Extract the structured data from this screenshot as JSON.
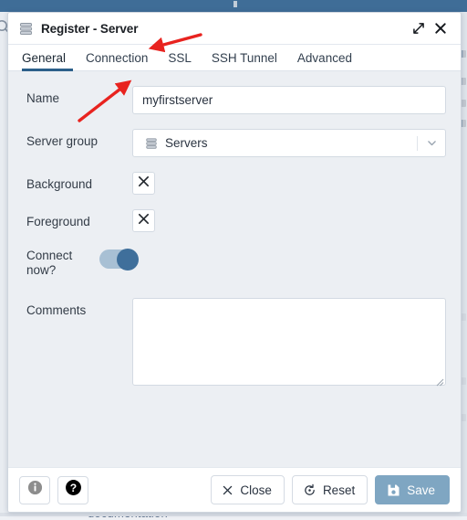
{
  "dialog": {
    "title": "Register - Server",
    "title_icon": "server-stack-icon",
    "maximize_icon": "expand-icon",
    "close_icon": "close-icon",
    "tabs": [
      {
        "label": "General",
        "active": true
      },
      {
        "label": "Connection",
        "active": false
      },
      {
        "label": "SSL",
        "active": false
      },
      {
        "label": "SSH Tunnel",
        "active": false
      },
      {
        "label": "Advanced",
        "active": false
      }
    ],
    "form": {
      "name": {
        "label": "Name",
        "value": "myfirstserver",
        "placeholder": ""
      },
      "server_group": {
        "label": "Server group",
        "value": "Servers",
        "icon": "server-group-icon",
        "caret_icon": "chevron-down-icon"
      },
      "background": {
        "label": "Background",
        "button_icon": "clear-color-x-icon"
      },
      "foreground": {
        "label": "Foreground",
        "button_icon": "clear-color-x-icon"
      },
      "connect_now": {
        "label": "Connect now?",
        "state": "on"
      },
      "comments": {
        "label": "Comments",
        "value": "",
        "placeholder": ""
      }
    },
    "footer": {
      "info_icon": "info-circle-icon",
      "help_icon": "help-circle-icon",
      "close_label": "Close",
      "close_icon": "close-x-icon",
      "reset_label": "Reset",
      "reset_icon": "reset-revert-icon",
      "save_label": "Save",
      "save_icon": "floppy-disk-icon"
    }
  },
  "backdrop": {
    "search_icon": "search-icon",
    "bottom_text": "documentation",
    "bottom_small_text": "_"
  },
  "colors": {
    "accent_blue": "#2c5f8a",
    "titlebar_strip": "#3f6d97",
    "toggle_track": "#a8c0d4",
    "toggle_knob": "#3f6f9b",
    "save_button": "#7fa6c2",
    "form_background": "#eceff3",
    "annotation_red": "#e8231f"
  }
}
